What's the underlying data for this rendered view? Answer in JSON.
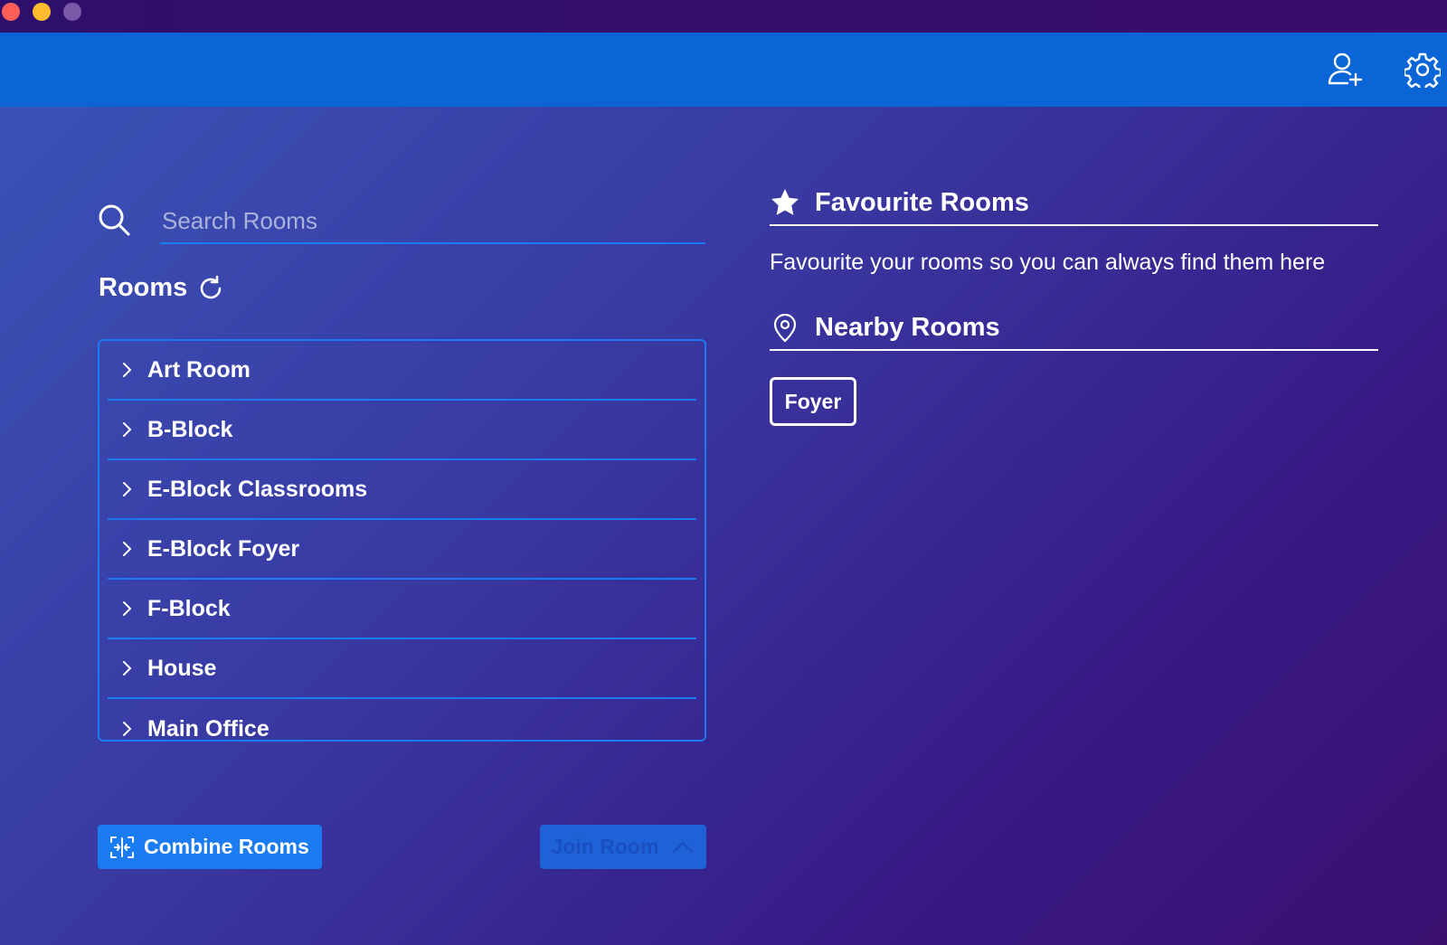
{
  "colors": {
    "header_bg": "#0b65d6",
    "accent": "#1a7cf0",
    "titlebar": "#2e0f6b"
  },
  "header": {
    "icons": [
      "add-user-icon",
      "gear-icon"
    ]
  },
  "search": {
    "placeholder": "Search Rooms",
    "value": ""
  },
  "rooms": {
    "title": "Rooms",
    "items": [
      {
        "label": "Art Room"
      },
      {
        "label": "B-Block"
      },
      {
        "label": "E-Block Classrooms"
      },
      {
        "label": "E-Block Foyer"
      },
      {
        "label": "F-Block"
      },
      {
        "label": "House"
      },
      {
        "label": "Main Office"
      }
    ]
  },
  "actions": {
    "combine_label": "Combine Rooms",
    "join_label": "Join Room"
  },
  "favourites": {
    "title": "Favourite Rooms",
    "description": "Favourite your rooms so you can always find them here"
  },
  "nearby": {
    "title": "Nearby Rooms",
    "chips": [
      "Foyer"
    ]
  }
}
